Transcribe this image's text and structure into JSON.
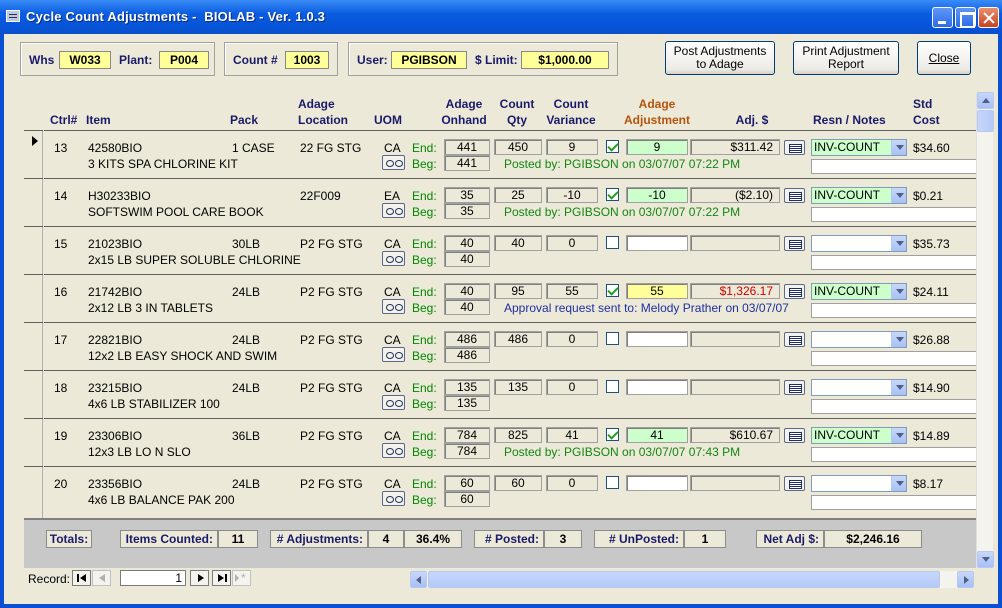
{
  "window": {
    "title": "Cycle Count Adjustments -  BIOLAB - Ver. 1.0.3"
  },
  "info": {
    "whs_label": "Whs",
    "whs_value": "W033",
    "plant_label": "Plant:",
    "plant_value": "P004",
    "count_label": "Count #",
    "count_value": "1003",
    "user_label": "User:",
    "user_value": "PGIBSON",
    "limit_label": "$ Limit:",
    "limit_value": "$1,000.00"
  },
  "buttons": {
    "post_line1": "Post Adjustments",
    "post_line2": "to Adage",
    "print_line1": "Print Adjustment",
    "print_line2": "Report",
    "close": "Close"
  },
  "columns": {
    "ctrl": "Ctrl#",
    "item": "Item",
    "pack": "Pack",
    "loc1": "Adage",
    "loc2": "Location",
    "uom": "UOM",
    "onhand1": "Adage",
    "onhand2": "Onhand",
    "qty1": "Count",
    "qty2": "Qty",
    "var1": "Count",
    "var2": "Variance",
    "adj1": "Adage",
    "adj2": "Adjustment",
    "adjd": "Adj. $",
    "resn": "Resn / Notes",
    "std1": "Std",
    "std2": "Cost"
  },
  "labels": {
    "end": "End:",
    "beg": "Beg:"
  },
  "rows": [
    {
      "ctrl": "13",
      "item": "42580BIO",
      "desc": "3 KITS SPA CHLORINE KIT",
      "pack": "1 CASE",
      "loc": "22 FG STG",
      "uom": "CA",
      "end": "441",
      "beg": "441",
      "qty": "450",
      "var": "9",
      "checked": true,
      "adj": "9",
      "adjd": "$311.42",
      "resn": "INV-COUNT",
      "std": "$34.60",
      "note": "Posted by: PGIBSON on 03/07/07 07:22 PM"
    },
    {
      "ctrl": "14",
      "item": "H30233BIO",
      "desc": "SOFTSWIM POOL CARE BOOK",
      "pack": "",
      "loc": "22F009",
      "uom": "EA",
      "end": "35",
      "beg": "35",
      "qty": "25",
      "var": "-10",
      "checked": true,
      "adj": "-10",
      "adjd": "($2.10)",
      "resn": "INV-COUNT",
      "std": "$0.21",
      "note": "Posted by: PGIBSON on 03/07/07 07:22 PM"
    },
    {
      "ctrl": "15",
      "item": "21023BIO",
      "desc": "2x15 LB SUPER SOLUBLE CHLORINE",
      "pack": "30LB",
      "loc": "P2 FG STG",
      "uom": "CA",
      "end": "40",
      "beg": "40",
      "qty": "40",
      "var": "0",
      "checked": false,
      "adj": "",
      "adjd": "",
      "resn": "",
      "std": "$35.73",
      "note": ""
    },
    {
      "ctrl": "16",
      "item": "21742BIO",
      "desc": "2x12 LB 3 IN TABLETS",
      "pack": "24LB",
      "loc": "P2 FG STG",
      "uom": "CA",
      "end": "40",
      "beg": "40",
      "qty": "95",
      "var": "55",
      "checked": true,
      "adj": "55",
      "adjd": "$1,326.17",
      "resn": "INV-COUNT",
      "std": "$24.11",
      "note": "Approval request sent to: Melody Prather on 03/07/07"
    },
    {
      "ctrl": "17",
      "item": "22821BIO",
      "desc": "12x2 LB EASY SHOCK AND SWIM",
      "pack": "24LB",
      "loc": "P2 FG STG",
      "uom": "CA",
      "end": "486",
      "beg": "486",
      "qty": "486",
      "var": "0",
      "checked": false,
      "adj": "",
      "adjd": "",
      "resn": "",
      "std": "$26.88",
      "note": ""
    },
    {
      "ctrl": "18",
      "item": "23215BIO",
      "desc": "4x6 LB STABILIZER 100",
      "pack": "24LB",
      "loc": "P2 FG STG",
      "uom": "CA",
      "end": "135",
      "beg": "135",
      "qty": "135",
      "var": "0",
      "checked": false,
      "adj": "",
      "adjd": "",
      "resn": "",
      "std": "$14.90",
      "note": ""
    },
    {
      "ctrl": "19",
      "item": "23306BIO",
      "desc": "12x3 LB LO N SLO",
      "pack": "36LB",
      "loc": "P2 FG STG",
      "uom": "CA",
      "end": "784",
      "beg": "784",
      "qty": "825",
      "var": "41",
      "checked": true,
      "adj": "41",
      "adjd": "$610.67",
      "resn": "INV-COUNT",
      "std": "$14.89",
      "note": "Posted by: PGIBSON on 03/07/07 07:43 PM"
    },
    {
      "ctrl": "20",
      "item": "23356BIO",
      "desc": "4x6 LB BALANCE PAK 200",
      "pack": "24LB",
      "loc": "P2 FG STG",
      "uom": "CA",
      "end": "60",
      "beg": "60",
      "qty": "60",
      "var": "0",
      "checked": false,
      "adj": "",
      "adjd": "",
      "resn": "",
      "std": "$8.17",
      "note": ""
    }
  ],
  "totals": {
    "label": "Totals:",
    "items_label": "Items Counted:",
    "items_value": "11",
    "adj_label": "# Adjustments:",
    "adj_value": "4",
    "adj_pct": "36.4%",
    "posted_label": "# Posted:",
    "posted_value": "3",
    "unposted_label": "# UnPosted:",
    "unposted_value": "1",
    "net_label": "Net Adj $:",
    "net_value": "$2,246.16"
  },
  "nav": {
    "record_label": "Record:",
    "record_value": "1"
  },
  "colors": {
    "highlight_yellow": "#ffff99",
    "posted_green": "#118811",
    "approval_blue": "#1f2fa0",
    "over_limit_red": "#cc0000",
    "adjust_green": "#ccffcc"
  }
}
